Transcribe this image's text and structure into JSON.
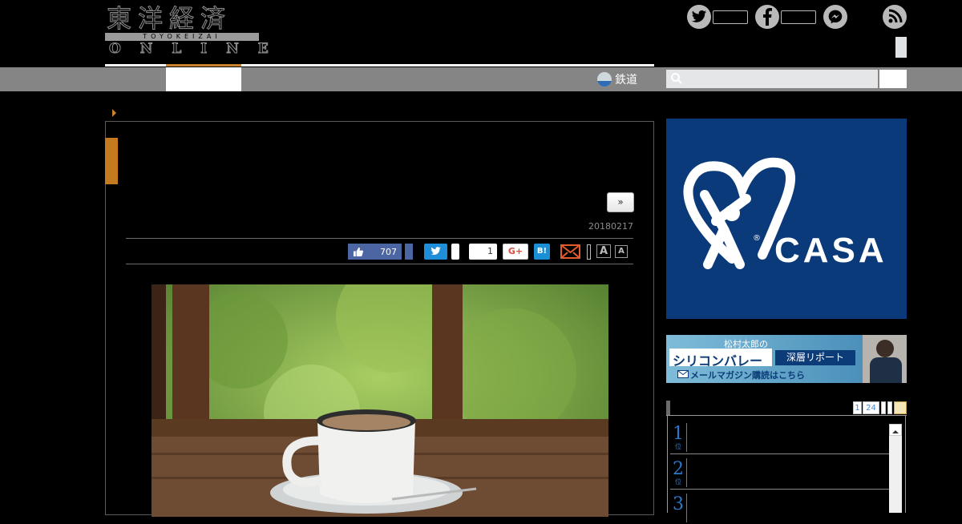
{
  "site": {
    "logo_jp": "東洋経済",
    "logo_sub": "TOYOKEIZAI",
    "logo_en": "ONLINE"
  },
  "social": {
    "icons": [
      "twitter-icon",
      "facebook-icon",
      "messenger-icon",
      "rss-icon"
    ]
  },
  "nav": {
    "rail_label": "鉄道"
  },
  "search": {
    "placeholder": "",
    "button_label": ""
  },
  "article": {
    "next_label": "»",
    "date": "20180217",
    "share": {
      "like_count": "707",
      "gplus_count": "1",
      "gplus_label": "G+",
      "hatena_label": "B!",
      "font_large": "A",
      "font_small": "A"
    }
  },
  "sidebar": {
    "ad_brand": "CASA",
    "ad_registered": "®",
    "banner": {
      "line1": "松村太郎の",
      "line2": "シリコンバレー",
      "line3": "深層リポート",
      "line4": "メールマガジン購読はこちら"
    },
    "ranking": {
      "tabs": [
        "1",
        "24"
      ],
      "items": [
        {
          "rank": "1",
          "suffix": "位"
        },
        {
          "rank": "2",
          "suffix": "位"
        },
        {
          "rank": "3",
          "suffix": "位"
        }
      ]
    }
  },
  "colors": {
    "accent": "#c8822d",
    "nav": "#858585",
    "ad_blue": "#0b3a7a"
  }
}
